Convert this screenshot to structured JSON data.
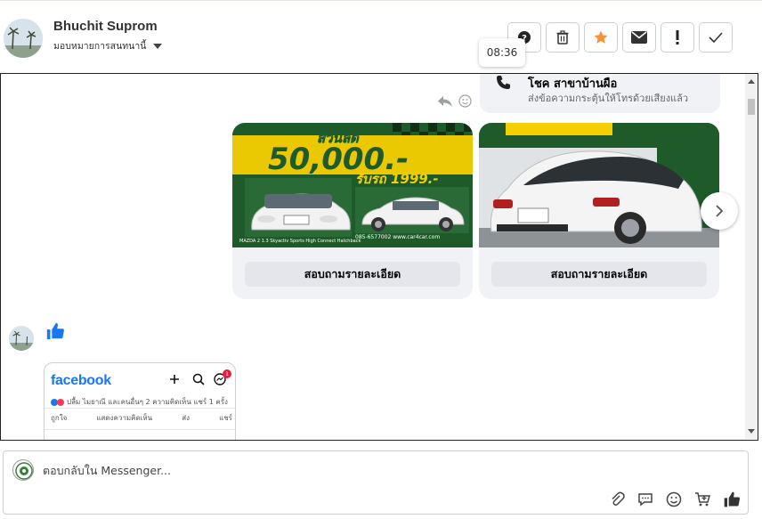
{
  "header": {
    "user_name": "Bhuchit Suprom",
    "assign_label": "มอบหมายการสนทนานี้",
    "tooltip_time": "08:36"
  },
  "toolbar": {
    "buttons": [
      {
        "name": "help-icon"
      },
      {
        "name": "trash-icon"
      },
      {
        "name": "star-icon",
        "color": "#f7923b"
      },
      {
        "name": "mail-icon"
      },
      {
        "name": "exclamation-icon"
      },
      {
        "name": "check-icon"
      }
    ]
  },
  "call": {
    "title": "โชค สาขาบ้านผือ",
    "subtitle": "ส่งข้อความกระตุ้นให้โทรด้วยเสียงแล้ว"
  },
  "carousel": {
    "cards": [
      {
        "button_label": "สอบถามรายละเอียด",
        "banner_top": "ส่วนลด",
        "banner_big": "50,000.-",
        "banner_sub": "รับรถ 1999.-",
        "banner_footer": "085-6577002  www.car4car.com",
        "banner_left_caption": "MAZDA 2 1.3 Skyactiv Sports High Connect Hatchback"
      },
      {
        "button_label": "สอบถามรายละเอียด"
      }
    ]
  },
  "fb_preview": {
    "logo": "facebook",
    "badge": "1",
    "meta": "ปลื้ม ไมยาณี และคนอื่นๆ  2 ความคิดเห็น  แชร์ 1 ครั้ง",
    "actions": [
      "ถูกใจ",
      "แสดงความคิดเห็น",
      "ส่ง",
      "แชร์"
    ]
  },
  "reply": {
    "placeholder": "ตอบกลับใน Messenger..."
  },
  "colors": {
    "brand_blue": "#1877f2",
    "star_orange": "#f7923b",
    "banner_yellow": "#f5d000",
    "banner_green": "#1e5a2a"
  }
}
